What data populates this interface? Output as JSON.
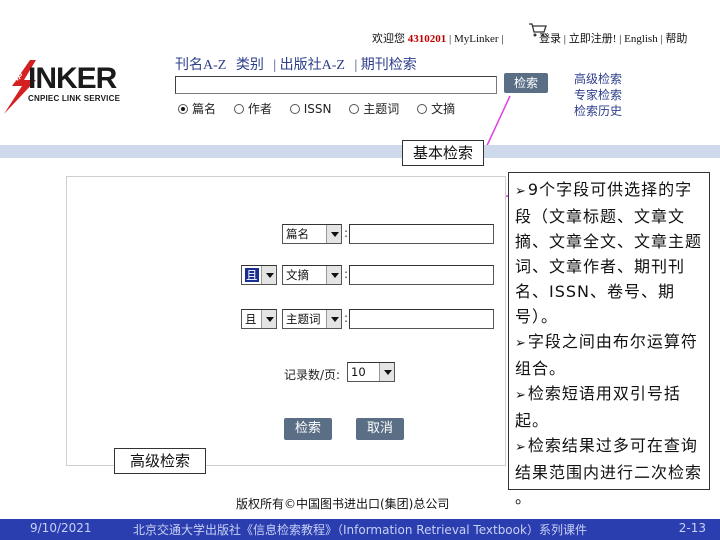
{
  "header": {
    "welcome": "欢迎您",
    "user_id": "4310201",
    "mylinker": "MyLinker",
    "cart_icon": "shopping-cart-icon",
    "login": "登录",
    "register": "立即注册!",
    "english": "English",
    "help": "帮助"
  },
  "logo": {
    "main": "INKER",
    "sub": "CNPIEC LINK SERVICE",
    "badge": "CNP"
  },
  "nav": {
    "items": [
      "刊名A-Z",
      "类别",
      "| 出版社A-Z",
      "| 期刊检索"
    ]
  },
  "search": {
    "button": "检索",
    "advanced": "高级检索",
    "expert": "专家检索",
    "history": "检索历史",
    "radios": [
      {
        "label": "篇名",
        "checked": true
      },
      {
        "label": "作者",
        "checked": false
      },
      {
        "label": "ISSN",
        "checked": false
      },
      {
        "label": "主题词",
        "checked": false
      },
      {
        "label": "文摘",
        "checked": false
      }
    ]
  },
  "labels": {
    "basic": "基本检索",
    "advanced": "高级检索"
  },
  "form": {
    "rows": [
      {
        "operator": "",
        "field": "篇名"
      },
      {
        "operator": "且",
        "field": "文摘"
      },
      {
        "operator": "且",
        "field": "主题词"
      }
    ],
    "records_label": "记录数/页:",
    "records_value": "10",
    "search_button": "检索",
    "cancel_button": "取消"
  },
  "callout": {
    "items": [
      "9个字段可供选择的字段（文章标题、文章文摘、文章全文、文章主题词、文章作者、期刊刊名、ISSN、卷号、期号）。",
      "字段之间由布尔运算符组合。",
      "检索短语用双引号括起。",
      "检索结果过多可在查询结果范围内进行二次检索 。"
    ]
  },
  "copyright": "版权所有©中国图书进出口(集团)总公司",
  "footer": {
    "date": "9/10/2021",
    "title": "北京交通大学出版社《信息检索教程》（Information Retrieval Textbook）系列课件",
    "page": "2-13"
  }
}
